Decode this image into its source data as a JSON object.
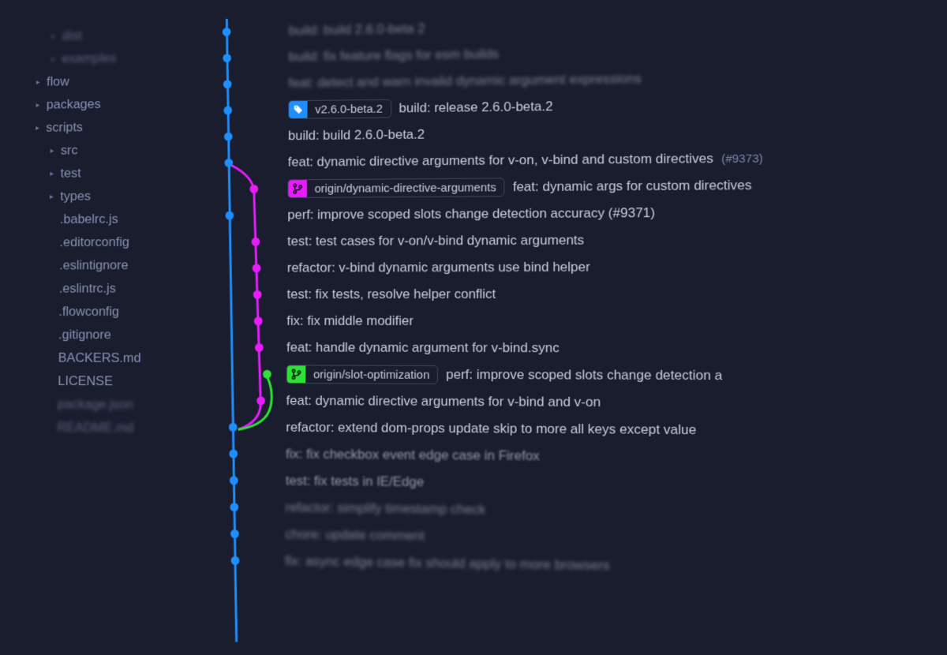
{
  "colors": {
    "blue": "#1e8fff",
    "pink": "#e81cff",
    "green": "#2ee038"
  },
  "sidebar": {
    "items": [
      {
        "label": "dist",
        "expandable": true,
        "indent": 2,
        "blurred": true
      },
      {
        "label": "examples",
        "expandable": true,
        "indent": 2,
        "blurred": true
      },
      {
        "label": "flow",
        "expandable": true,
        "indent": 1,
        "blurred": false
      },
      {
        "label": "packages",
        "expandable": true,
        "indent": 1,
        "blurred": false
      },
      {
        "label": "scripts",
        "expandable": true,
        "indent": 1,
        "blurred": false
      },
      {
        "label": "src",
        "expandable": true,
        "indent": 2,
        "blurred": false
      },
      {
        "label": "test",
        "expandable": true,
        "indent": 2,
        "blurred": false
      },
      {
        "label": "types",
        "expandable": true,
        "indent": 2,
        "blurred": false
      },
      {
        "label": ".babelrc.js",
        "expandable": false,
        "indent": 2,
        "blurred": false
      },
      {
        "label": ".editorconfig",
        "expandable": false,
        "indent": 2,
        "blurred": false
      },
      {
        "label": ".eslintignore",
        "expandable": false,
        "indent": 2,
        "blurred": false
      },
      {
        "label": ".eslintrc.js",
        "expandable": false,
        "indent": 2,
        "blurred": false
      },
      {
        "label": ".flowconfig",
        "expandable": false,
        "indent": 2,
        "blurred": false
      },
      {
        "label": ".gitignore",
        "expandable": false,
        "indent": 2,
        "blurred": false
      },
      {
        "label": "BACKERS.md",
        "expandable": false,
        "indent": 2,
        "blurred": false
      },
      {
        "label": "LICENSE",
        "expandable": false,
        "indent": 2,
        "blurred": false
      },
      {
        "label": "package.json",
        "expandable": false,
        "indent": 2,
        "blurred": true
      },
      {
        "label": "README.md",
        "expandable": false,
        "indent": 2,
        "blurred": true
      }
    ]
  },
  "commits": [
    {
      "msg": "build: build 2.6.0-beta 2",
      "lane": "blue",
      "blurred": "blurred"
    },
    {
      "msg": "build: fix feature flags for esm builds",
      "lane": "blue",
      "blurred": "blurred"
    },
    {
      "msg": "feat: detect and warn invalid dynamic argument expressions",
      "lane": "blue",
      "blurred": "blurred"
    },
    {
      "tag": {
        "label": "v2.6.0-beta.2",
        "color": "blue",
        "icon": "tag"
      },
      "msg": "build: release 2.6.0-beta.2",
      "lane": "blue"
    },
    {
      "msg": "build: build 2.6.0-beta.2",
      "lane": "blue"
    },
    {
      "msg": "feat: dynamic directive arguments for v-on, v-bind and custom directives",
      "issue": "(#9373)",
      "lane": "blue"
    },
    {
      "tag": {
        "label": "origin/dynamic-directive-arguments",
        "color": "pink",
        "icon": "branch"
      },
      "msg": "feat: dynamic args for custom directives",
      "lane": "pink"
    },
    {
      "msg": "perf: improve scoped slots change detection accuracy (#9371)",
      "lane": "blue"
    },
    {
      "msg": "test: test cases for v-on/v-bind dynamic arguments",
      "lane": "pink"
    },
    {
      "msg": "refactor: v-bind dynamic arguments use bind helper",
      "lane": "pink"
    },
    {
      "msg": "test: fix tests, resolve helper conflict",
      "lane": "pink"
    },
    {
      "msg": "fix: fix middle modifier",
      "lane": "pink"
    },
    {
      "msg": "feat: handle dynamic argument for v-bind.sync",
      "lane": "pink"
    },
    {
      "tag": {
        "label": "origin/slot-optimization",
        "color": "green",
        "icon": "branch"
      },
      "msg": "perf: improve scoped slots change detection a",
      "lane": "green"
    },
    {
      "msg": "feat: dynamic directive arguments for v-bind and v-on",
      "lane": "pink"
    },
    {
      "msg": "refactor: extend dom-props update skip to more all keys except value",
      "lane": "blue"
    },
    {
      "msg": "fix: fix checkbox event edge case in Firefox",
      "lane": "blue",
      "blurred": "blur-light"
    },
    {
      "msg": "test: fix tests in IE/Edge",
      "lane": "blue",
      "blurred": "blur-light"
    },
    {
      "msg": "refactor: simplify timestamp check",
      "lane": "blue",
      "blurred": "blurred"
    },
    {
      "msg": "chore: update comment",
      "lane": "blue",
      "blurred": "blurred"
    },
    {
      "msg": "fix: async edge case fix should apply to more browsers",
      "lane": "blue",
      "blurred": "blurred"
    }
  ]
}
